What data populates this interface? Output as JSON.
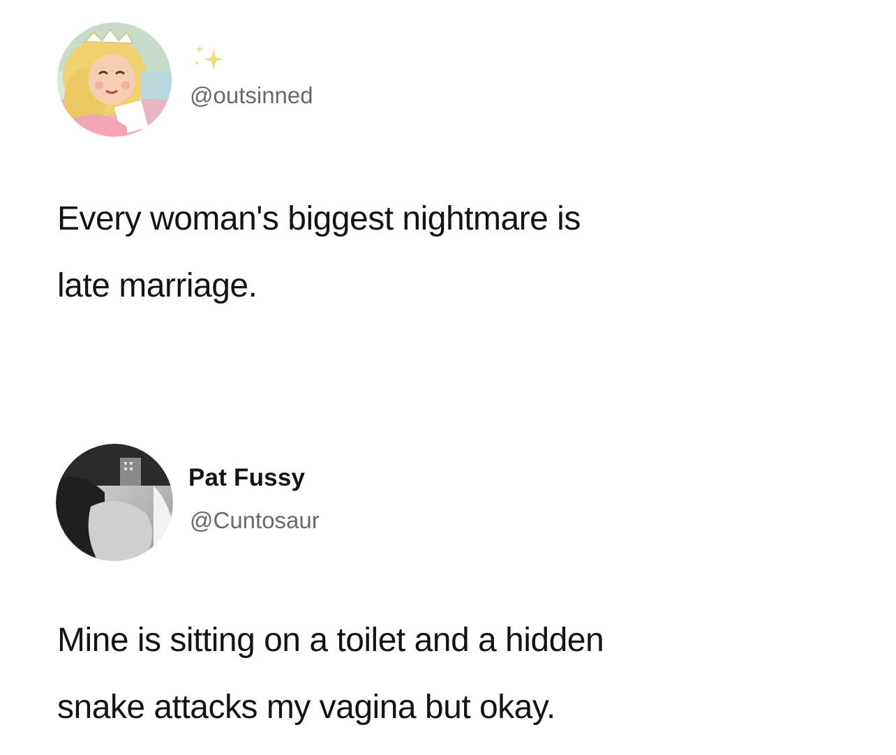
{
  "tweets": [
    {
      "handle": "@outsinned",
      "text_lines": [
        "Every woman's biggest nightmare is",
        "late marriage."
      ]
    },
    {
      "display_name": "Pat Fussy",
      "handle": "@Cuntosaur",
      "text_lines": [
        "Mine is sitting on a toilet and a hidden",
        "snake attacks my vagina but okay."
      ]
    }
  ]
}
